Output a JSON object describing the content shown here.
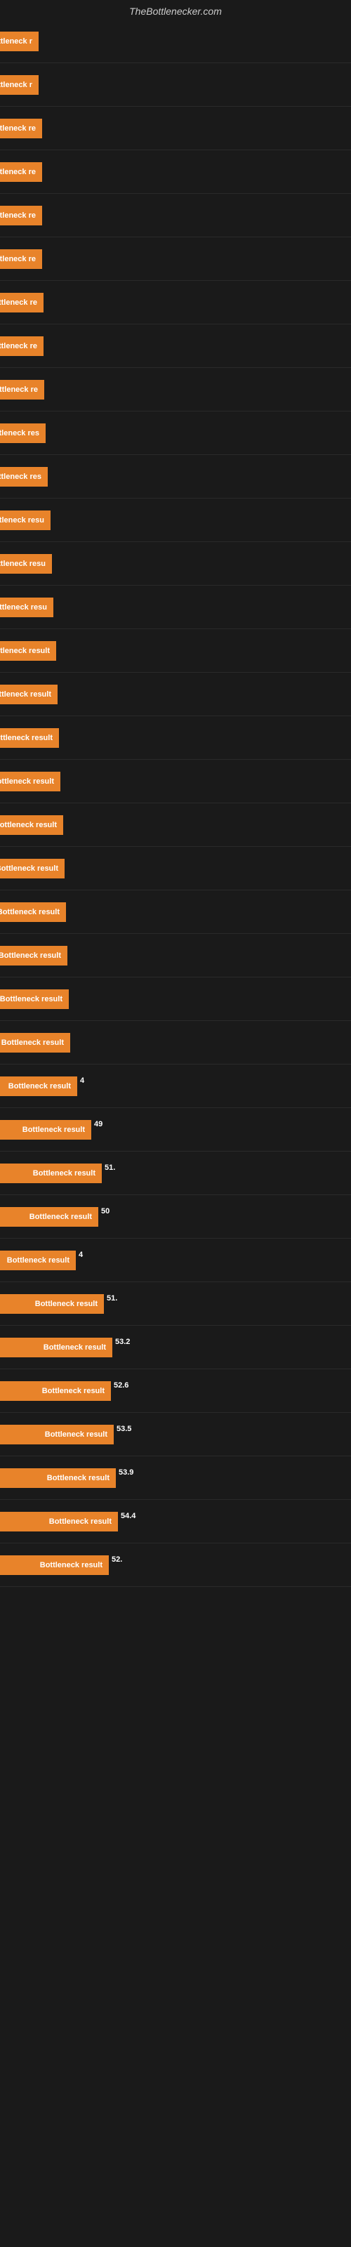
{
  "site": {
    "title": "TheBottlenecker.com"
  },
  "chart": {
    "rows": [
      {
        "label": "Bottleneck r",
        "value": "",
        "width": 55
      },
      {
        "label": "Bottleneck r",
        "value": "",
        "width": 55
      },
      {
        "label": "Bottleneck re",
        "value": "",
        "width": 60
      },
      {
        "label": "Bottleneck re",
        "value": "",
        "width": 60
      },
      {
        "label": "Bottleneck re",
        "value": "",
        "width": 60
      },
      {
        "label": "Bottleneck re",
        "value": "",
        "width": 60
      },
      {
        "label": "Bottleneck re",
        "value": "",
        "width": 62
      },
      {
        "label": "Bottleneck re",
        "value": "",
        "width": 62
      },
      {
        "label": "Bottleneck re",
        "value": "",
        "width": 63
      },
      {
        "label": "Bottleneck res",
        "value": "",
        "width": 65
      },
      {
        "label": "Bottleneck res",
        "value": "",
        "width": 68
      },
      {
        "label": "Bottleneck resu",
        "value": "",
        "width": 72
      },
      {
        "label": "Bottleneck resu",
        "value": "",
        "width": 74
      },
      {
        "label": "Bottleneck resu",
        "value": "",
        "width": 76
      },
      {
        "label": "Bottleneck result",
        "value": "",
        "width": 80
      },
      {
        "label": "Bottleneck result",
        "value": "",
        "width": 82
      },
      {
        "label": "Bottleneck result",
        "value": "",
        "width": 84
      },
      {
        "label": "Bottleneck result",
        "value": "",
        "width": 86
      },
      {
        "label": "Bottleneck result",
        "value": "",
        "width": 90
      },
      {
        "label": "Bottleneck result",
        "value": "",
        "width": 92
      },
      {
        "label": "Bottleneck result",
        "value": "",
        "width": 94
      },
      {
        "label": "Bottleneck result",
        "value": "",
        "width": 96
      },
      {
        "label": "Bottleneck result",
        "value": "",
        "width": 98
      },
      {
        "label": "Bottleneck result",
        "value": "",
        "width": 100
      },
      {
        "label": "Bottleneck result",
        "value": "4",
        "width": 110
      },
      {
        "label": "Bottleneck result",
        "value": "49",
        "width": 130
      },
      {
        "label": "Bottleneck result",
        "value": "51.",
        "width": 145
      },
      {
        "label": "Bottleneck result",
        "value": "50",
        "width": 140
      },
      {
        "label": "Bottleneck result",
        "value": "4",
        "width": 108
      },
      {
        "label": "Bottleneck result",
        "value": "51.",
        "width": 148
      },
      {
        "label": "Bottleneck result",
        "value": "53.2",
        "width": 160
      },
      {
        "label": "Bottleneck result",
        "value": "52.6",
        "width": 158
      },
      {
        "label": "Bottleneck result",
        "value": "53.5",
        "width": 162
      },
      {
        "label": "Bottleneck result",
        "value": "53.9",
        "width": 165
      },
      {
        "label": "Bottleneck result",
        "value": "54.4",
        "width": 168
      },
      {
        "label": "Bottleneck result",
        "value": "52.",
        "width": 155
      }
    ]
  }
}
